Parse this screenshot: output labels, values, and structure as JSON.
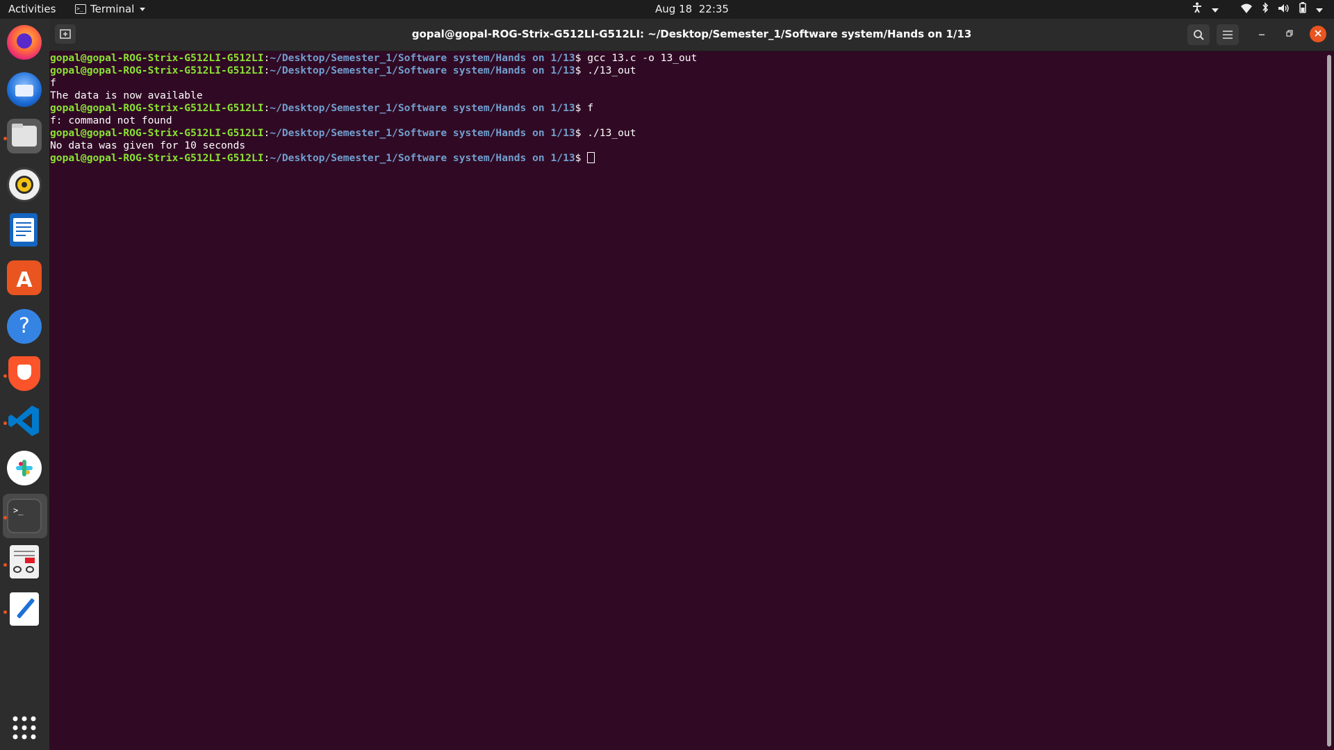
{
  "topbar": {
    "activities": "Activities",
    "app_name": "Terminal",
    "date": "Aug 18",
    "time": "22:35"
  },
  "dock": {
    "apps": [
      {
        "name": "Firefox",
        "icon": "firefox-icon"
      },
      {
        "name": "Thunderbird",
        "icon": "thunderbird-icon"
      },
      {
        "name": "Files",
        "icon": "files-icon"
      },
      {
        "name": "Rhythmbox",
        "icon": "rhythmbox-icon"
      },
      {
        "name": "LibreOffice Writer",
        "icon": "writer-icon"
      },
      {
        "name": "Ubuntu Software",
        "icon": "software-icon"
      },
      {
        "name": "Help",
        "icon": "help-icon"
      },
      {
        "name": "Brave",
        "icon": "brave-icon"
      },
      {
        "name": "Visual Studio Code",
        "icon": "vscode-icon"
      },
      {
        "name": "Slack",
        "icon": "slack-icon"
      },
      {
        "name": "Terminal",
        "icon": "terminal-icon"
      },
      {
        "name": "Document Viewer",
        "icon": "document-viewer-icon"
      },
      {
        "name": "Text Editor",
        "icon": "text-editor-icon"
      }
    ],
    "show_apps": "show-applications-icon"
  },
  "window": {
    "title": "gopal@gopal-ROG-Strix-G512LI-G512LI: ~/Desktop/Semester_1/Software system/Hands on 1/13"
  },
  "terminal": {
    "user_host": "gopal@gopal-ROG-Strix-G512LI-G512LI",
    "path": "~/Desktop/Semester_1/Software system/Hands on 1/13",
    "lines": [
      {
        "type": "prompt",
        "command": "gcc 13.c -o 13_out"
      },
      {
        "type": "prompt",
        "command": "./13_out"
      },
      {
        "type": "output",
        "text": "f"
      },
      {
        "type": "output",
        "text": "The data is now available"
      },
      {
        "type": "prompt",
        "command": "f"
      },
      {
        "type": "output",
        "text": "f: command not found"
      },
      {
        "type": "prompt",
        "command": "./13_out"
      },
      {
        "type": "output",
        "text": "No data was given for 10 seconds"
      },
      {
        "type": "prompt",
        "command": "",
        "cursor": true
      }
    ]
  },
  "colors": {
    "terminal_bg": "#300a24",
    "prompt_user": "#8ae234",
    "prompt_path": "#729fcf",
    "accent": "#e95420"
  }
}
